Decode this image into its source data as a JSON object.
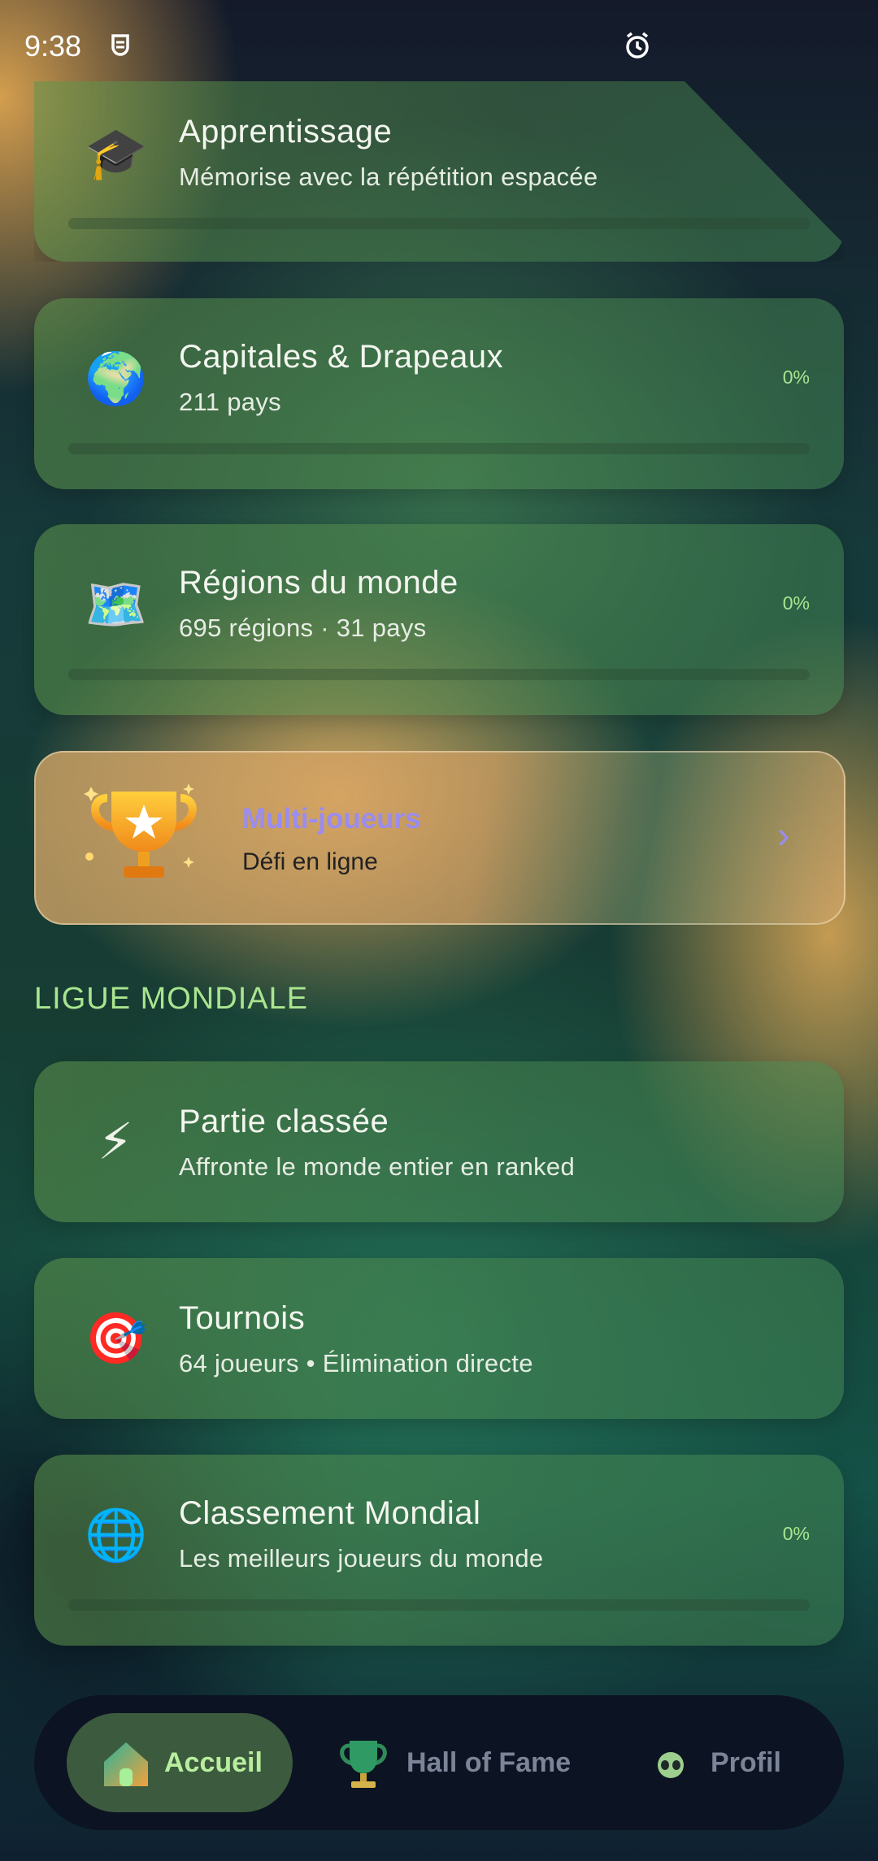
{
  "status_bar": {
    "time": "9:38"
  },
  "cards": [
    {
      "id": "apprentissage",
      "icon": "graduation-cap-icon",
      "glyph": "🎓",
      "title": "Apprentissage",
      "subtitle": "Mémorise avec la répétition espacée"
    },
    {
      "id": "capitales",
      "icon": "globe-africa-icon",
      "glyph": "🌍",
      "title": "Capitales & Drapeaux",
      "subtitle": "211 pays",
      "percent": "0%",
      "progress": 0
    },
    {
      "id": "regions",
      "icon": "world-map-icon",
      "glyph": "🗺️",
      "title": "Régions du monde",
      "subtitle": "695 régions · 31 pays",
      "percent": "0%",
      "progress": 0
    }
  ],
  "multiplayer": {
    "icon": "trophy-icon",
    "title": "Multi-joueurs",
    "subtitle": "Défi en ligne",
    "chevron_icon": "chevron-right-icon"
  },
  "section_title": "LIGUE MONDIALE",
  "league_cards": [
    {
      "id": "ranked",
      "icon": "lightning-icon",
      "glyph": "⚡",
      "title": "Partie classée",
      "subtitle": "Affronte le monde entier en ranked"
    },
    {
      "id": "tournois",
      "icon": "target-icon",
      "glyph": "🎯",
      "title": "Tournois",
      "subtitle": "64 joueurs • Élimination directe"
    },
    {
      "id": "classement",
      "icon": "globe-meridians-icon",
      "glyph": "🌐",
      "title": "Classement Mondial",
      "subtitle": "Les meilleurs joueurs du monde",
      "percent": "0%",
      "progress": 0
    }
  ],
  "nav": {
    "items": [
      {
        "label": "Accueil",
        "icon": "home-icon",
        "active": true
      },
      {
        "label": "Hall of Fame",
        "icon": "trophy-icon",
        "active": false
      },
      {
        "label": "Profil",
        "icon": "alien-avatar-icon",
        "active": false
      }
    ]
  },
  "colors": {
    "accent_green": "#a9e58f",
    "multiplayer_purple": "#9a8cf0",
    "nav_bg": "#0c1322"
  }
}
